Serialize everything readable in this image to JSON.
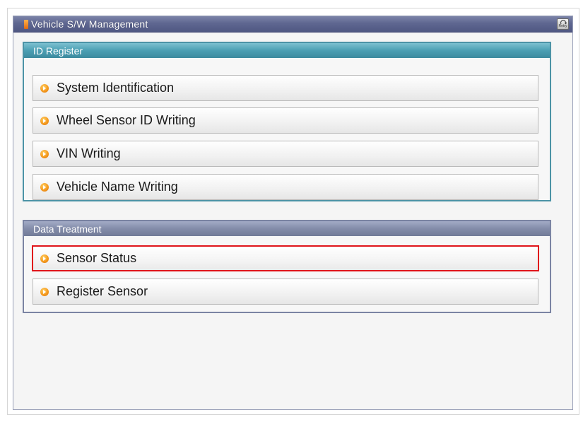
{
  "window": {
    "title": "Vehicle S/W Management",
    "retry_label": "Retry"
  },
  "groups": [
    {
      "title": "ID Register",
      "items": [
        {
          "label": "System Identification"
        },
        {
          "label": "Wheel Sensor ID Writing"
        },
        {
          "label": "VIN Writing"
        },
        {
          "label": "Vehicle Name Writing"
        }
      ]
    },
    {
      "title": "Data Treatment",
      "items": [
        {
          "label": "Sensor Status",
          "selected": true
        },
        {
          "label": "Register Sensor"
        }
      ]
    }
  ],
  "colors": {
    "title_bar": "#5f6791",
    "id_register_header": "#4b9fb3",
    "data_treatment_header": "#838ca9",
    "selection_border": "#e0141a",
    "bullet": "#f59a1e"
  },
  "icons": {
    "title_marker": "orange-bar-icon",
    "retry": "retry-icon",
    "bullet": "orange-arrow-bullet-icon"
  }
}
